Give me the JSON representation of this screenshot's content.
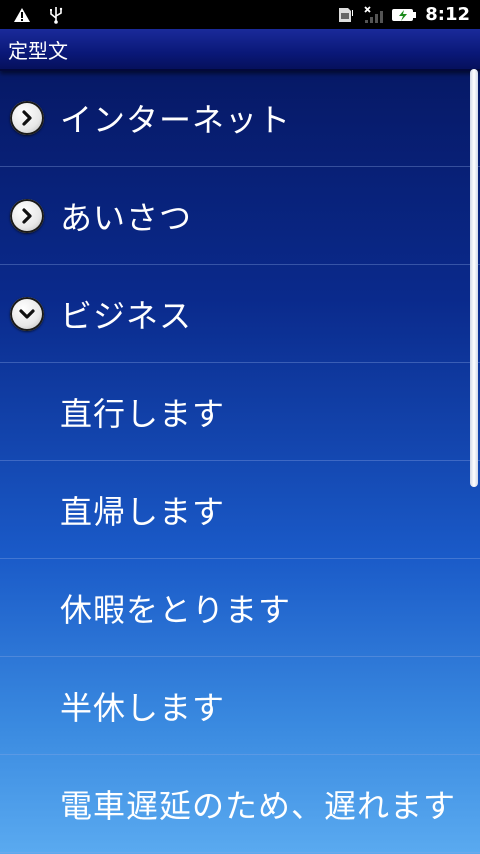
{
  "status_bar": {
    "time": "8:12",
    "icons": [
      "warning-icon",
      "usb-icon",
      "sim-icon",
      "no-signal-icon",
      "battery-charging-icon"
    ]
  },
  "title": "定型文",
  "items": [
    {
      "label": "インターネット",
      "type": "group",
      "expanded": false
    },
    {
      "label": "あいさつ",
      "type": "group",
      "expanded": false
    },
    {
      "label": "ビジネス",
      "type": "group",
      "expanded": true
    },
    {
      "label": "直行します",
      "type": "child"
    },
    {
      "label": "直帰します",
      "type": "child"
    },
    {
      "label": "休暇をとります",
      "type": "child"
    },
    {
      "label": "半休します",
      "type": "child"
    },
    {
      "label": "電車遅延のため、遅れます",
      "type": "child"
    }
  ]
}
